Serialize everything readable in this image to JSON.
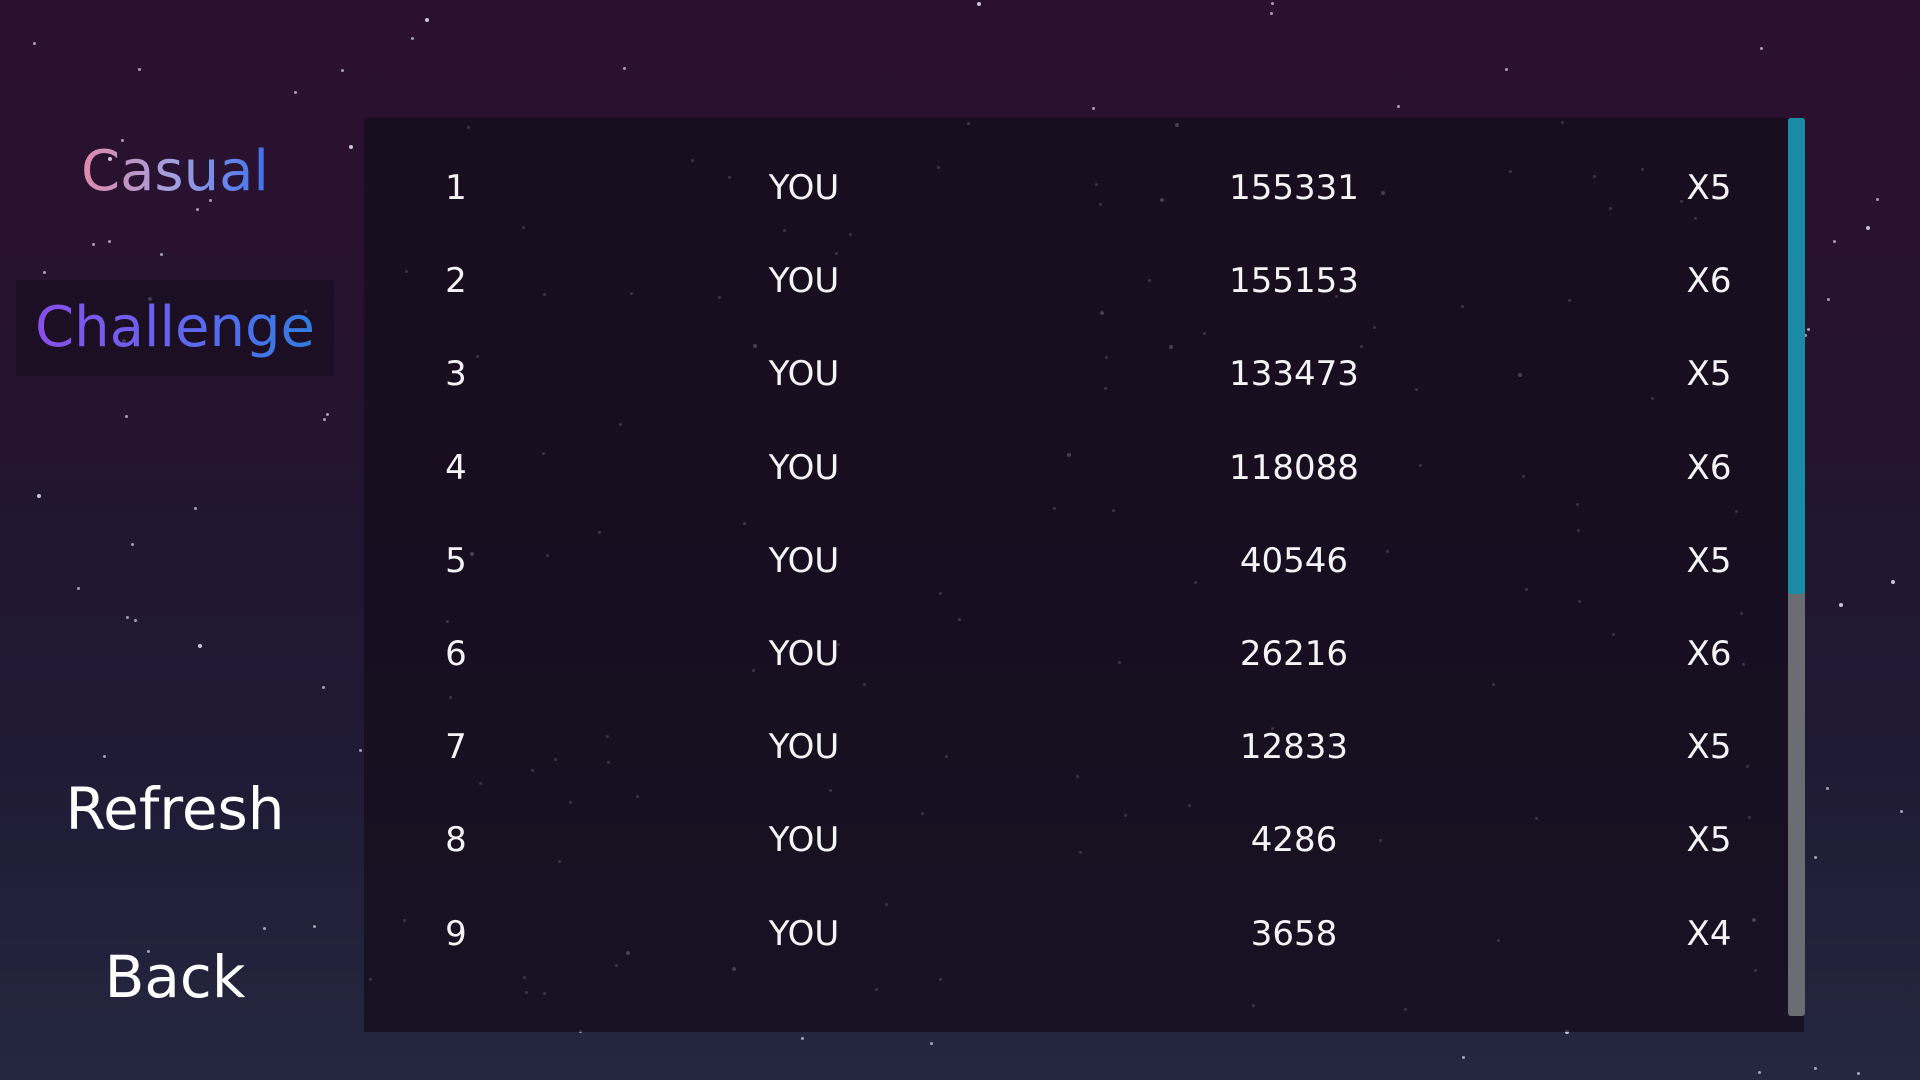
{
  "modes": {
    "casual": "Casual",
    "challenge": "Challenge",
    "selected": "Challenge"
  },
  "buttons": {
    "refresh": "Refresh",
    "back": "Back"
  },
  "leaderboard": {
    "rows": [
      {
        "rank": "1",
        "name": "YOU",
        "score": "155331",
        "multiplier": "X5"
      },
      {
        "rank": "2",
        "name": "YOU",
        "score": "155153",
        "multiplier": "X6"
      },
      {
        "rank": "3",
        "name": "YOU",
        "score": "133473",
        "multiplier": "X5"
      },
      {
        "rank": "4",
        "name": "YOU",
        "score": "118088",
        "multiplier": "X6"
      },
      {
        "rank": "5",
        "name": "YOU",
        "score": "40546",
        "multiplier": "X5"
      },
      {
        "rank": "6",
        "name": "YOU",
        "score": "26216",
        "multiplier": "X6"
      },
      {
        "rank": "7",
        "name": "YOU",
        "score": "12833",
        "multiplier": "X5"
      },
      {
        "rank": "8",
        "name": "YOU",
        "score": "4286",
        "multiplier": "X5"
      },
      {
        "rank": "9",
        "name": "YOU",
        "score": "3658",
        "multiplier": "X4"
      }
    ],
    "scroll_fraction_visible": 0.53
  },
  "colors": {
    "scroll_thumb": "#1a8aa6",
    "scroll_track": "#6b6b72"
  }
}
